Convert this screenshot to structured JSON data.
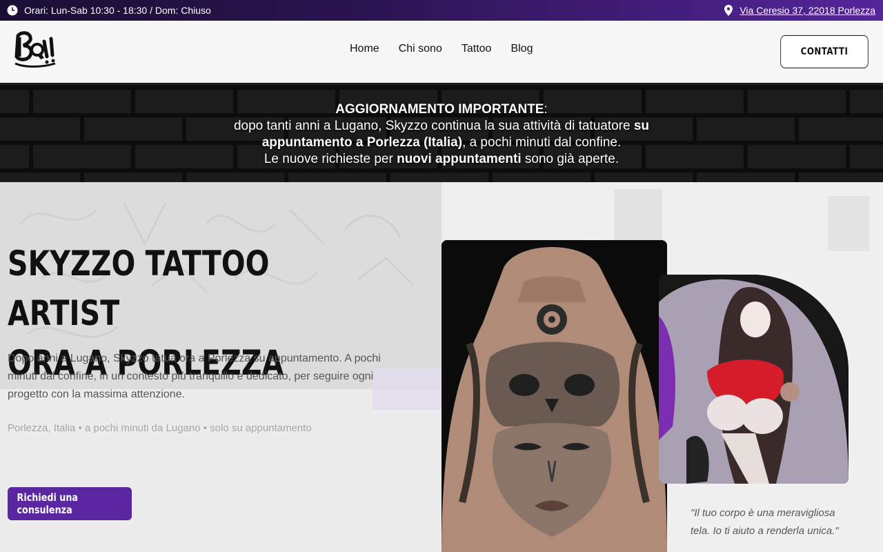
{
  "topbar": {
    "hours": "Orari: Lun-Sab 10:30 - 18:30 / Dom: Chiuso",
    "address": "Via Ceresio 37, 22018 Porlezza",
    "clock_icon": "clock-icon",
    "pin_icon": "map-pin-icon"
  },
  "header": {
    "logo_text": "Boy!!",
    "nav": [
      "Home",
      "Chi sono",
      "Tattoo",
      "Blog"
    ],
    "contact_label": "CONTATTI"
  },
  "announcement": {
    "heading": "AGGIORNAMENTO IMPORTANTE",
    "colon": ":",
    "line1_a": "dopo tanti anni a Lugano, Skyzzo continua la sua attività di tatuatore ",
    "line1_b": "su appuntamento a Porlezza (Italia)",
    "line1_c": ", a pochi minuti dal confine.",
    "line2_a": "Le nuove richieste per ",
    "line2_b": "nuovi appuntamenti",
    "line2_c": " sono già aperte."
  },
  "hero": {
    "title_line1": "SKYZZO TATTOO ARTIST",
    "title_line2": "ORA A PORLEZZA",
    "description": "Dopo anni a Lugano, Skyzzo tatua ora a Porlezza su appuntamento. A pochi minuti dal confine, in un contesto più tranquillo e dedicato, per seguire ogni progetto con la massima attenzione.",
    "meta": "Porlezza, Italia • a pochi minuti da Lugano • solo su appuntamento",
    "cta_label": "Richiedi una consulenza",
    "quote": "\"Il tuo corpo è una meravigliosa tela. Io ti aiuto a renderla unica.\""
  },
  "colors": {
    "topbar_start": "#1b0e33",
    "topbar_end": "#55259a",
    "accent": "#5b27a0",
    "text_dark": "#111111",
    "text_muted": "#555555"
  }
}
